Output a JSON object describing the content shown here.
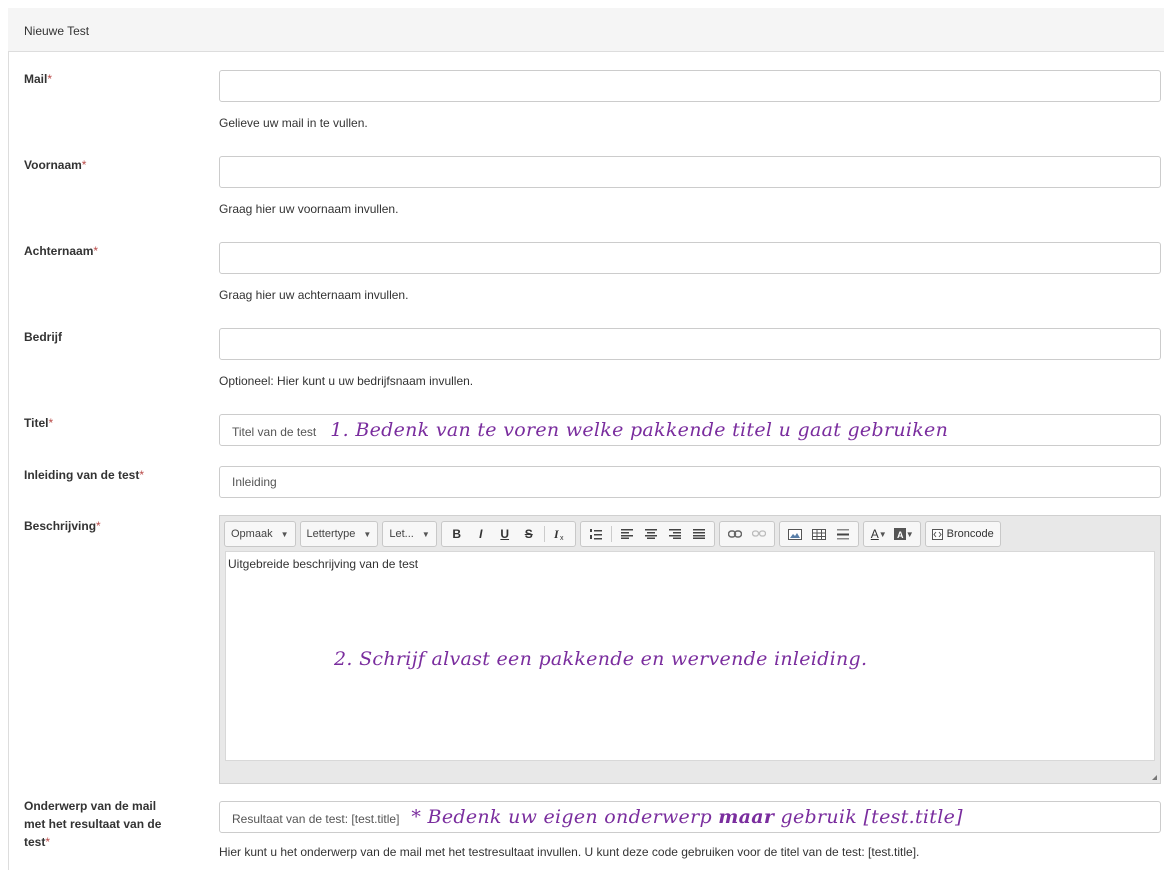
{
  "panel": {
    "title": "Nieuwe Test"
  },
  "required_mark": "*",
  "fields": {
    "mail": {
      "label": "Mail",
      "value": "",
      "help": "Gelieve uw mail in te vullen."
    },
    "voornaam": {
      "label": "Voornaam",
      "value": "",
      "help": "Graag hier uw voornaam invullen."
    },
    "achternaam": {
      "label": "Achternaam",
      "value": "",
      "help": "Graag hier uw achternaam invullen."
    },
    "bedrijf": {
      "label": "Bedrijf",
      "value": "",
      "help": "Optioneel: Hier kunt u uw bedrijfsnaam invullen."
    },
    "titel": {
      "label": "Titel",
      "value": "Titel van de test"
    },
    "inleiding": {
      "label": "Inleiding van de test",
      "value": "Inleiding"
    },
    "beschrijving": {
      "label": "Beschrijving",
      "content": "Uitgebreide beschrijving van de test"
    },
    "onderwerp": {
      "label_line1": "Onderwerp van de mail",
      "label_line2": "met het resultaat van de",
      "label_line3": "test",
      "value": "Resultaat van de test: [test.title]",
      "help": "Hier kunt u het onderwerp van de mail met het testresultaat invullen. U kunt deze code gebruiken voor de titel van de test: [test.title]."
    }
  },
  "toolbar": {
    "format": "Opmaak",
    "font": "Lettertype",
    "size": "Let...",
    "bold": "B",
    "italic": "I",
    "underline": "U",
    "strike": "S",
    "clear": "Ix",
    "text_color": "A",
    "source": "Broncode"
  },
  "annotations": {
    "titel": "1. Bedenk van te voren welke pakkende titel u gaat gebruiken",
    "beschrijving": "2. Schrijf alvast een pakkende en wervende inleiding.",
    "onderwerp_pre": "* Bedenk uw eigen onderwerp ",
    "onderwerp_bold": "maar",
    "onderwerp_post": " gebruik [test.title]"
  },
  "colors": {
    "required": "#b94a48",
    "annotation": "#7a2d9e",
    "header_bg": "#f5f5f5"
  }
}
